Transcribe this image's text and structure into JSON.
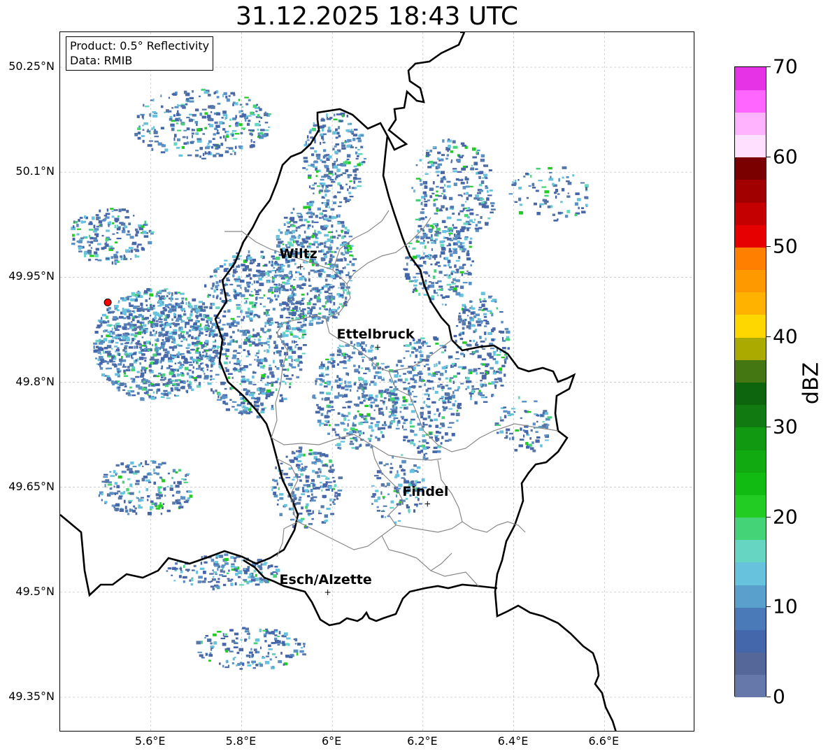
{
  "title": "31.12.2025 18:43 UTC",
  "info_box": {
    "product": "Product: 0.5° Reflectivity",
    "data": "Data: RMIB"
  },
  "map": {
    "extent": {
      "lon_min": 5.4,
      "lon_max": 6.8,
      "lat_min": 49.3,
      "lat_max": 50.3
    },
    "lat_ticks": [
      {
        "value": 50.25,
        "label": "50.25°N"
      },
      {
        "value": 50.1,
        "label": "50.1°N"
      },
      {
        "value": 49.95,
        "label": "49.95°N"
      },
      {
        "value": 49.8,
        "label": "49.8°N"
      },
      {
        "value": 49.65,
        "label": "49.65°N"
      },
      {
        "value": 49.5,
        "label": "49.5°N"
      },
      {
        "value": 49.35,
        "label": "49.35°N"
      }
    ],
    "lon_ticks": [
      {
        "value": 5.6,
        "label": "5.6°E"
      },
      {
        "value": 5.8,
        "label": "5.8°E"
      },
      {
        "value": 6.0,
        "label": "6°E"
      },
      {
        "value": 6.2,
        "label": "6.2°E"
      },
      {
        "value": 6.4,
        "label": "6.4°E"
      },
      {
        "value": 6.6,
        "label": "6.6°E"
      }
    ],
    "cities": [
      {
        "name": "Wiltz",
        "lon": 5.93,
        "lat": 49.965
      },
      {
        "name": "Ettelbruck",
        "lon": 6.1,
        "lat": 49.85
      },
      {
        "name": "Findel",
        "lon": 6.21,
        "lat": 49.626
      },
      {
        "name": "Esch/Alzette",
        "lon": 5.99,
        "lat": 49.5
      }
    ],
    "radar_site": {
      "lon": 5.505,
      "lat": 49.914,
      "color": "#ff0000"
    },
    "grid": "on"
  },
  "colorbar": {
    "label": "dBZ",
    "min": 0,
    "max": 70,
    "ticks": [
      {
        "value": 0,
        "label": "0"
      },
      {
        "value": 10,
        "label": "10"
      },
      {
        "value": 20,
        "label": "20"
      },
      {
        "value": 30,
        "label": "30"
      },
      {
        "value": 40,
        "label": "40"
      },
      {
        "value": 50,
        "label": "50"
      },
      {
        "value": 60,
        "label": "60"
      },
      {
        "value": 70,
        "label": "70"
      }
    ],
    "colors": [
      "#6677aa",
      "#556699",
      "#4466aa",
      "#4a7ab8",
      "#5aa0cc",
      "#66c2dd",
      "#66d6c2",
      "#44d477",
      "#22cc22",
      "#11bb11",
      "#11aa11",
      "#119911",
      "#117a11",
      "#0d650d",
      "#447711",
      "#aaaa00",
      "#ffd700",
      "#ffb300",
      "#ff9900",
      "#ff7f00",
      "#e60000",
      "#c40000",
      "#a00000",
      "#7a0000",
      "#ffe0ff",
      "#ffb3ff",
      "#ff66ff",
      "#e633e6"
    ]
  }
}
